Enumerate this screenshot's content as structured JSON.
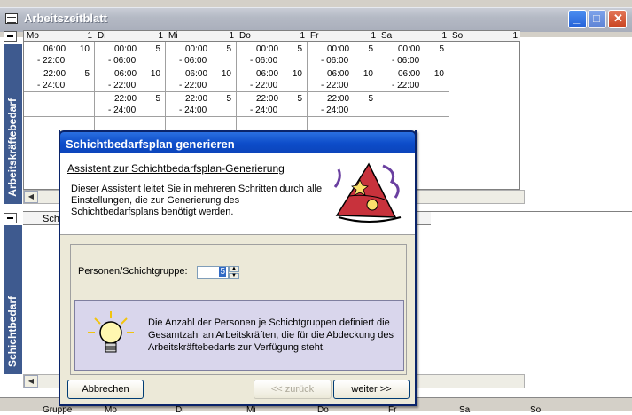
{
  "window": {
    "title": "Arbeitszeitblatt",
    "minimize": "_",
    "maximize": "□",
    "close": "✕"
  },
  "bands": {
    "top": "Arbeitskräftebedarf",
    "bottom": "Schichtbedarf"
  },
  "days": [
    {
      "name": "Mo",
      "num": "1",
      "cells": [
        {
          "t1": "06:00",
          "t2": "- 22:00",
          "c": "10"
        },
        {
          "t1": "22:00",
          "t2": "- 24:00",
          "c": "5"
        },
        {
          "t1": "",
          "t2": "",
          "c": ""
        }
      ]
    },
    {
      "name": "Di",
      "num": "1",
      "cells": [
        {
          "t1": "00:00",
          "t2": "- 06:00",
          "c": "5"
        },
        {
          "t1": "06:00",
          "t2": "- 22:00",
          "c": "10"
        },
        {
          "t1": "22:00",
          "t2": "- 24:00",
          "c": "5"
        }
      ]
    },
    {
      "name": "Mi",
      "num": "1",
      "cells": [
        {
          "t1": "00:00",
          "t2": "- 06:00",
          "c": "5"
        },
        {
          "t1": "06:00",
          "t2": "- 22:00",
          "c": "10"
        },
        {
          "t1": "22:00",
          "t2": "- 24:00",
          "c": "5"
        }
      ]
    },
    {
      "name": "Do",
      "num": "1",
      "cells": [
        {
          "t1": "00:00",
          "t2": "- 06:00",
          "c": "5"
        },
        {
          "t1": "06:00",
          "t2": "- 22:00",
          "c": "10"
        },
        {
          "t1": "22:00",
          "t2": "- 24:00",
          "c": "5"
        }
      ]
    },
    {
      "name": "Fr",
      "num": "1",
      "cells": [
        {
          "t1": "00:00",
          "t2": "- 06:00",
          "c": "5"
        },
        {
          "t1": "06:00",
          "t2": "- 22:00",
          "c": "10"
        },
        {
          "t1": "22:00",
          "t2": "- 24:00",
          "c": "5"
        }
      ]
    },
    {
      "name": "Sa",
      "num": "1",
      "cells": [
        {
          "t1": "00:00",
          "t2": "- 06:00",
          "c": "5"
        },
        {
          "t1": "06:00",
          "t2": "- 22:00",
          "c": "10"
        },
        {
          "t1": "",
          "t2": "",
          "c": ""
        }
      ]
    },
    {
      "name": "So",
      "num": "1",
      "cells": [
        {
          "t1": "",
          "t2": "",
          "c": ""
        },
        {
          "t1": "",
          "t2": "",
          "c": ""
        },
        {
          "t1": "",
          "t2": "",
          "c": ""
        }
      ]
    }
  ],
  "sheet2": {
    "header": "Sch"
  },
  "bottom_labels": [
    "Gruppe",
    "Mo",
    "Di",
    "Mi",
    "Do",
    "Fr",
    "Sa",
    "So"
  ],
  "dialog": {
    "title": "Schichtbedarfsplan generieren",
    "heading": "Assistent zur Schichtbedarfsplan-Generierung",
    "description": "Dieser Assistent leitet Sie in mehreren Schritten durch alle Einstellungen, die zur Generierung des Schichtbedarfsplans benötigt werden.",
    "field_label": "Personen/Schichtgruppe:",
    "field_value": "5",
    "info": "Die Anzahl der Personen je Schichtgruppen definiert die Gesamtzahl an Arbeitskräften, die für die Abdeckung des Arbeitskräftebedarfs zur Verfügung steht.",
    "buttons": {
      "cancel": "Abbrechen",
      "back": "<< zurück",
      "next": "weiter >>"
    }
  }
}
